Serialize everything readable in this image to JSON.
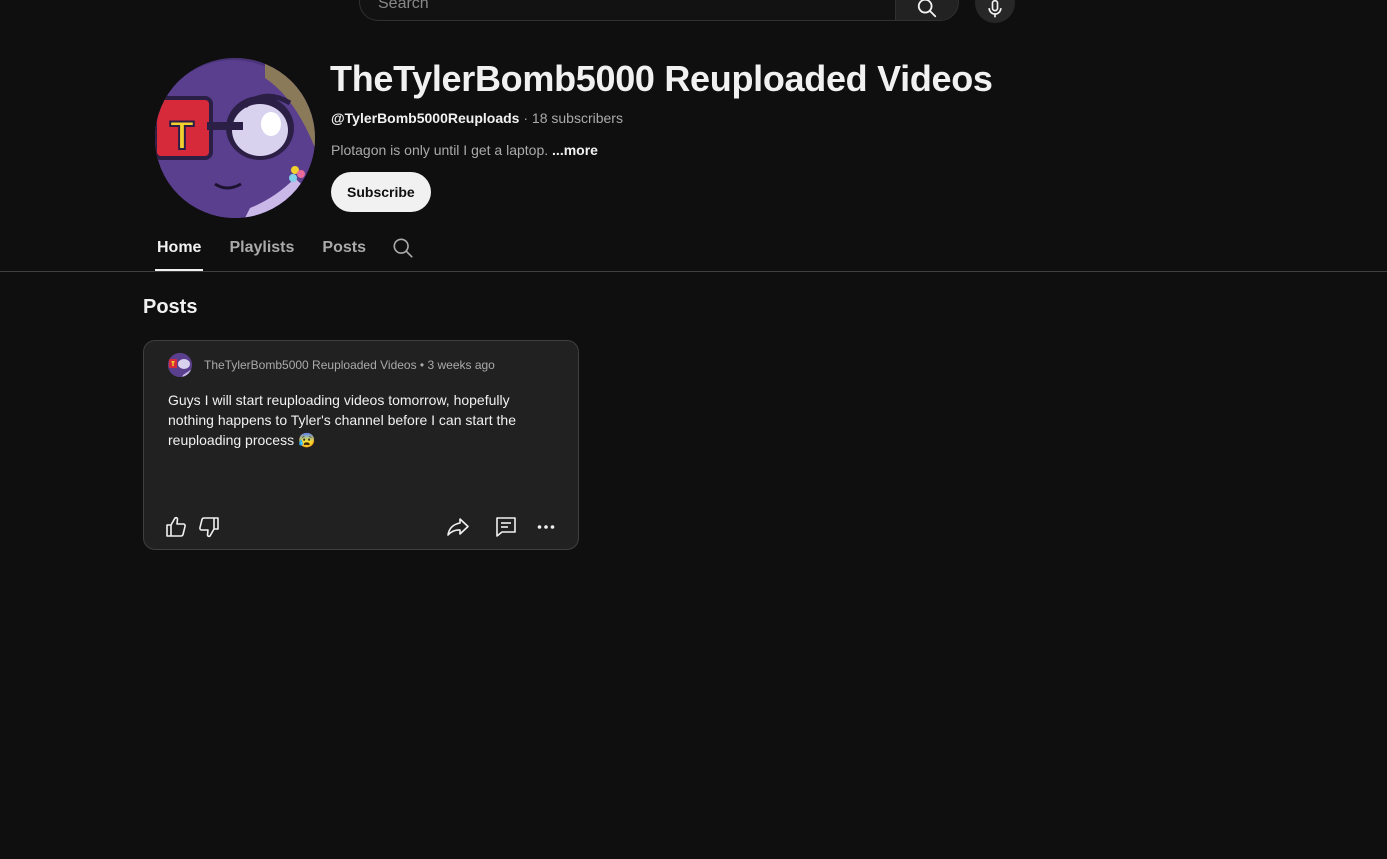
{
  "search": {
    "placeholder": "Search"
  },
  "channel": {
    "title": "TheTylerBomb5000 Reuploaded Videos",
    "handle": "@TylerBomb5000Reuploads",
    "separator": " · ",
    "subscribers": "18 subscribers",
    "description": "Plotagon is only until I get a laptop.",
    "more_label": "...more",
    "subscribe_label": "Subscribe",
    "avatar_letter": "T"
  },
  "tabs": [
    {
      "label": "Home",
      "active": true
    },
    {
      "label": "Playlists",
      "active": false
    },
    {
      "label": "Posts",
      "active": false
    }
  ],
  "section": {
    "title": "Posts"
  },
  "post": {
    "author": "TheTylerBomb5000 Reuploaded Videos",
    "separator": " • ",
    "time": "3 weeks ago",
    "text": "Guys I will start reuploading videos tomorrow, hopefully nothing happens to Tyler's channel before I can start the reuploading process 😰"
  },
  "icons": {
    "search": "search-icon",
    "mic": "mic-icon",
    "like": "thumbs-up-icon",
    "dislike": "thumbs-down-icon",
    "share": "share-icon",
    "comment": "comment-icon",
    "more": "more-icon"
  },
  "colors": {
    "background": "#0f0f0f",
    "card": "#212121",
    "text": "#f1f1f1",
    "secondary_text": "#aaaaaa",
    "subscribe_bg": "#f1f1f1",
    "avatar_purple": "#5b3f8f",
    "badge_red": "#d62a3a",
    "badge_yellow": "#f2d12e"
  }
}
